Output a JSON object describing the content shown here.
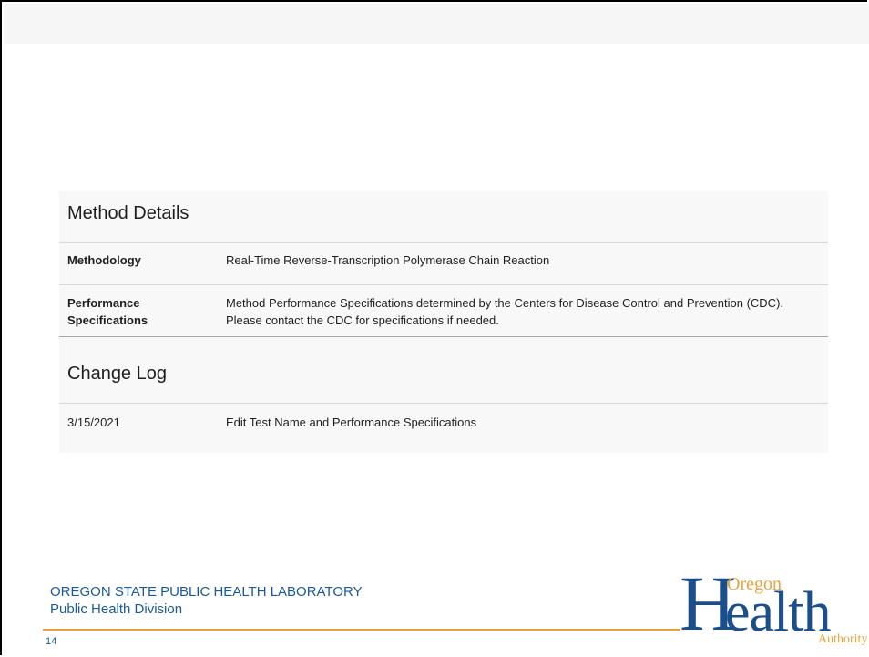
{
  "method_details": {
    "title": "Method Details",
    "rows": [
      {
        "label": "Methodology",
        "value": "Real-Time Reverse-Transcription Polymerase Chain Reaction"
      },
      {
        "label": "Performance Specifications",
        "value": "Method Performance Specifications determined by the Centers for Disease Control and Prevention (CDC). Please contact the CDC for specifications if needed."
      }
    ]
  },
  "change_log": {
    "title": "Change Log",
    "rows": [
      {
        "date": "3/15/2021",
        "description": "Edit Test Name and Performance Specifications"
      }
    ]
  },
  "footer": {
    "organization": "OREGON STATE PUBLIC HEALTH LABORATORY",
    "division": "Public Health Division",
    "page_number": "14"
  },
  "logo": {
    "oregon": "Oregon",
    "health_h": "H",
    "health_rest": "ealth",
    "authority": "Authority"
  },
  "colors": {
    "brand_blue": "#1c4f8a",
    "accent_orange": "#e8a33a"
  }
}
